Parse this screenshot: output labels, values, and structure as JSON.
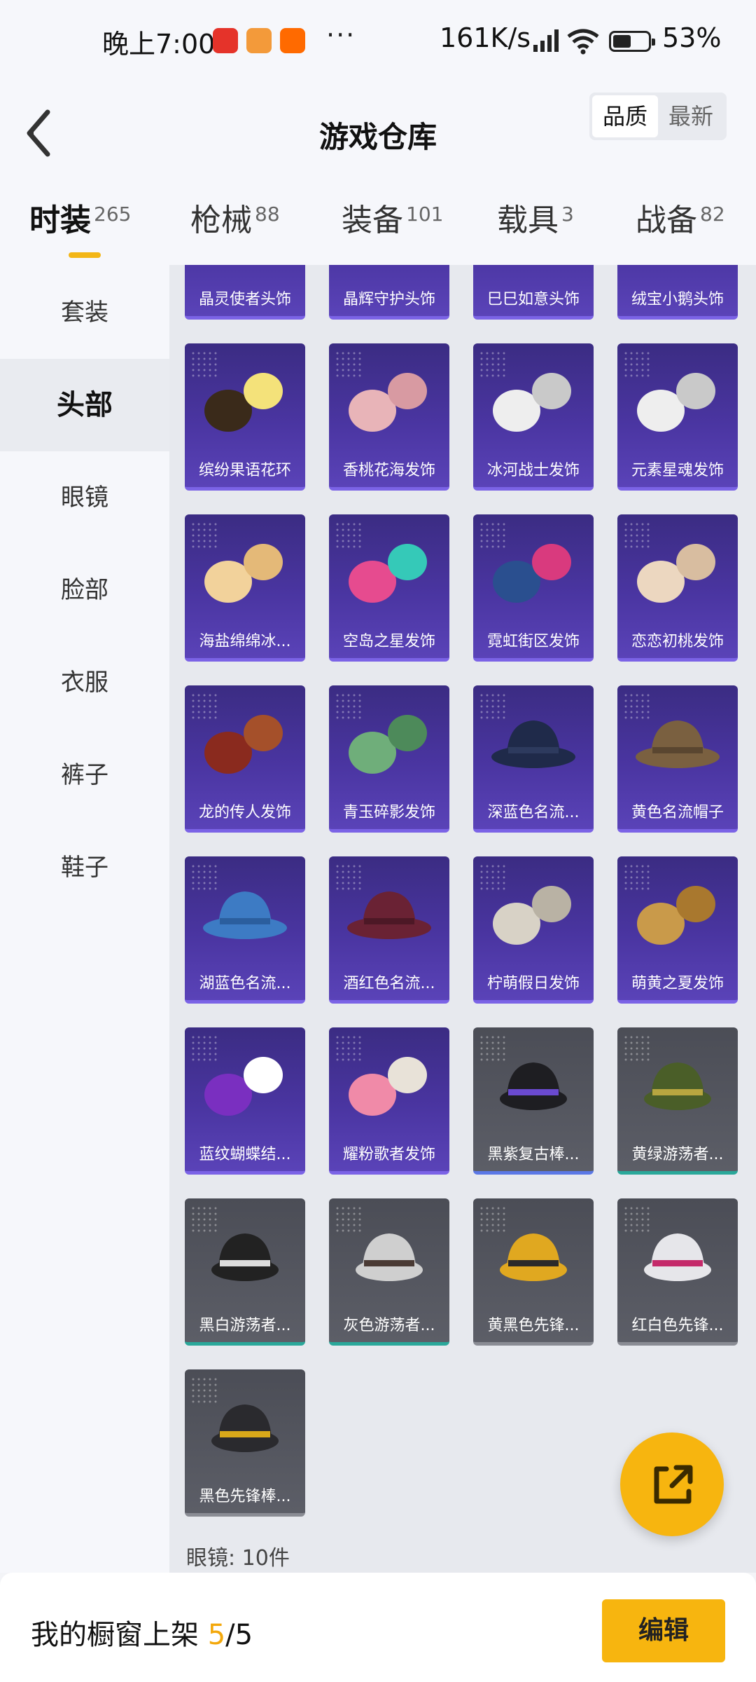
{
  "status_bar": {
    "time": "晚上7:00",
    "dots": "···",
    "net_speed": "161K/s",
    "battery_percent": "53%",
    "battery_level": 0.53,
    "app_icon_colors": [
      "#e5332a",
      "#f39a3a",
      "#ff6a00"
    ]
  },
  "header": {
    "title": "游戏仓库",
    "back_icon": "chevron-left-icon",
    "sort_options": [
      "品质",
      "最新"
    ],
    "sort_selected": "品质"
  },
  "categories": [
    {
      "label": "时装",
      "count": "265",
      "active": true
    },
    {
      "label": "枪械",
      "count": "88",
      "active": false
    },
    {
      "label": "装备",
      "count": "101",
      "active": false
    },
    {
      "label": "载具",
      "count": "3",
      "active": false
    },
    {
      "label": "战备",
      "count": "82",
      "active": false
    }
  ],
  "sidebar": {
    "items": [
      {
        "label": "套装",
        "active": false
      },
      {
        "label": "头部",
        "active": true
      },
      {
        "label": "眼镜",
        "active": false
      },
      {
        "label": "脸部",
        "active": false
      },
      {
        "label": "衣服",
        "active": false
      },
      {
        "label": "裤子",
        "active": false
      },
      {
        "label": "鞋子",
        "active": false
      }
    ]
  },
  "items": [
    {
      "name": "晶灵使者头饰",
      "rarity": "purple",
      "icon": "headwear-icon"
    },
    {
      "name": "晶辉守护头饰",
      "rarity": "purple",
      "icon": "headwear-icon"
    },
    {
      "name": "巳巳如意头饰",
      "rarity": "purple",
      "icon": "headwear-icon"
    },
    {
      "name": "绒宝小鹅头饰",
      "rarity": "purple",
      "icon": "headwear-icon"
    },
    {
      "name": "缤纷果语花环",
      "rarity": "purple",
      "icon": "flower-wreath-hair-icon"
    },
    {
      "name": "香桃花海发饰",
      "rarity": "purple",
      "icon": "pink-hair-icon"
    },
    {
      "name": "冰河战士发饰",
      "rarity": "purple",
      "icon": "white-hair-icon"
    },
    {
      "name": "元素星魂发饰",
      "rarity": "purple",
      "icon": "white-hair-icon"
    },
    {
      "name": "海盐绵绵冰...",
      "rarity": "purple",
      "icon": "blonde-hair-icon"
    },
    {
      "name": "空岛之星发饰",
      "rarity": "purple",
      "icon": "mask-hair-icon"
    },
    {
      "name": "霓虹街区发饰",
      "rarity": "purple",
      "icon": "neon-hair-icon"
    },
    {
      "name": "恋恋初桃发饰",
      "rarity": "purple",
      "icon": "beige-hair-icon"
    },
    {
      "name": "龙的传人发饰",
      "rarity": "purple",
      "icon": "red-hair-icon"
    },
    {
      "name": "青玉碎影发饰",
      "rarity": "purple",
      "icon": "green-hair-icon"
    },
    {
      "name": "深蓝色名流...",
      "rarity": "purple",
      "icon": "navy-fedora-icon"
    },
    {
      "name": "黄色名流帽子",
      "rarity": "purple",
      "icon": "brown-fedora-icon"
    },
    {
      "name": "湖蓝色名流...",
      "rarity": "purple",
      "icon": "blue-fedora-icon"
    },
    {
      "name": "酒红色名流...",
      "rarity": "purple",
      "icon": "wine-fedora-icon"
    },
    {
      "name": "柠萌假日发饰",
      "rarity": "purple",
      "icon": "silver-hair-icon"
    },
    {
      "name": "萌黄之夏发饰",
      "rarity": "purple",
      "icon": "gold-hair-icon"
    },
    {
      "name": "蓝纹蝴蝶结...",
      "rarity": "purple",
      "icon": "purple-bow-hair-icon"
    },
    {
      "name": "耀粉歌者发饰",
      "rarity": "purple",
      "icon": "pink-bob-hair-icon"
    },
    {
      "name": "黑紫复古棒...",
      "rarity": "gray",
      "line": "blue",
      "icon": "black-cap-icon"
    },
    {
      "name": "黄绿游荡者...",
      "rarity": "gray",
      "line": "teal",
      "icon": "striped-beanie-icon"
    },
    {
      "name": "黑白游荡者...",
      "rarity": "gray",
      "line": "teal",
      "icon": "zebra-beanie-icon"
    },
    {
      "name": "灰色游荡者...",
      "rarity": "gray",
      "line": "teal",
      "icon": "gray-beanie-icon"
    },
    {
      "name": "黄黑色先锋...",
      "rarity": "gray",
      "line": "gray",
      "icon": "yellow-cap-icon"
    },
    {
      "name": "红白色先锋...",
      "rarity": "gray",
      "line": "gray",
      "icon": "red-white-cap-icon"
    },
    {
      "name": "黑色先锋棒...",
      "rarity": "gray",
      "line": "gray",
      "icon": "black-yellow-cap-icon"
    }
  ],
  "footnote": "眼镜: 10件",
  "fab": {
    "icon": "share-external-icon"
  },
  "bottom_bar": {
    "label": "我的橱窗上架",
    "current": "5",
    "separator": "/",
    "total": "5",
    "edit_label": "编辑"
  },
  "colors": {
    "accent": "#f7b50f",
    "purple_card": "#4a35a1",
    "gray_card": "#555761"
  }
}
